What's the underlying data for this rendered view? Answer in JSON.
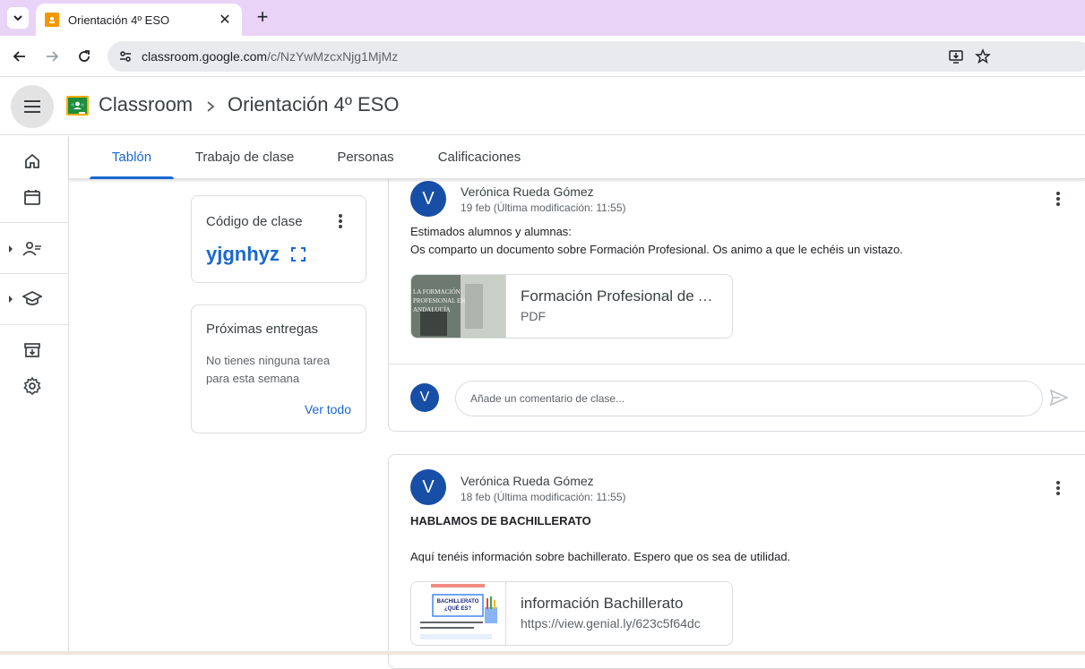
{
  "browser": {
    "tab_title": "Orientación 4º ESO",
    "url_host": "classroom.google.com",
    "url_path": "/c/NzYwMzcxNjg1MjMz"
  },
  "header": {
    "app_name": "Classroom",
    "class_name": "Orientación 4º ESO"
  },
  "tabs": [
    {
      "label": "Tablón"
    },
    {
      "label": "Trabajo de clase"
    },
    {
      "label": "Personas"
    },
    {
      "label": "Calificaciones"
    }
  ],
  "class_code": {
    "title": "Código de clase",
    "value": "yjgnhyz"
  },
  "upcoming": {
    "title": "Próximas entregas",
    "text": "No tienes ninguna tarea para esta semana",
    "link": "Ver todo"
  },
  "posts": [
    {
      "avatar": "V",
      "author": "Verónica Rueda Gómez",
      "date": "19 feb (Última modificación: 11:55)",
      "line1": "Estimados alumnos y alumnas:",
      "line2": "Os comparto un documento sobre Formación Profesional. Os animo a que le echéis un vistazo.",
      "attachment": {
        "title": "Formación Profesional de Andalucía",
        "subtitle": "PDF",
        "thumb_text": "LA FORMACIÓN PROFESIONAL EN ANDALUCÍA"
      },
      "comment_placeholder": "Añade un comentario de clase..."
    },
    {
      "avatar": "V",
      "author": "Verónica Rueda Gómez",
      "date": "18 feb (Última modificación: 11:55)",
      "heading": "HABLAMOS DE BACHILLERATO",
      "line1": "Aquí tenéis información sobre bachillerato. Espero que os sea de utilidad.",
      "attachment": {
        "title": "información Bachillerato",
        "subtitle": "https://view.genial.ly/623c5f64dc",
        "thumb_text": "BACHILLERATO ¿QUÉ ES?"
      }
    }
  ],
  "comment_avatar": "V",
  "colors": {
    "accent": "#1967d2",
    "avatar": "#174ea6",
    "tabstrip": "#e9d4f7"
  }
}
